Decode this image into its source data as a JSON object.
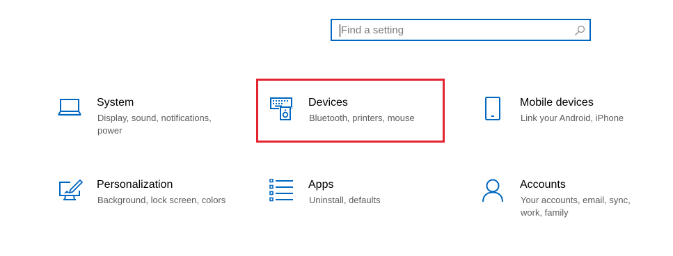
{
  "search": {
    "placeholder": "Find a setting",
    "icon": "search-icon"
  },
  "tiles": [
    {
      "title": "System",
      "desc_line1": "Display, sound, notifications,",
      "desc_line2": "power",
      "icon": "laptop-icon"
    },
    {
      "title": "Devices",
      "desc_line1": "Bluetooth, printers, mouse",
      "desc_line2": "",
      "icon": "devices-icon"
    },
    {
      "title": "Mobile devices",
      "desc_line1": "Link your Android, iPhone",
      "desc_line2": "",
      "icon": "phone-icon"
    },
    {
      "title": "Personalization",
      "desc_line1": "Background, lock screen, colors",
      "desc_line2": "",
      "icon": "personalization-icon"
    },
    {
      "title": "Apps",
      "desc_line1": "Uninstall, defaults",
      "desc_line2": "",
      "icon": "apps-list-icon"
    },
    {
      "title": "Accounts",
      "desc_line1": "Your accounts, email, sync,",
      "desc_line2": "work, family",
      "icon": "person-icon"
    }
  ],
  "colors": {
    "accent": "#0067c0",
    "highlight": "#e3232f",
    "desc_text": "#5d5d5d"
  }
}
